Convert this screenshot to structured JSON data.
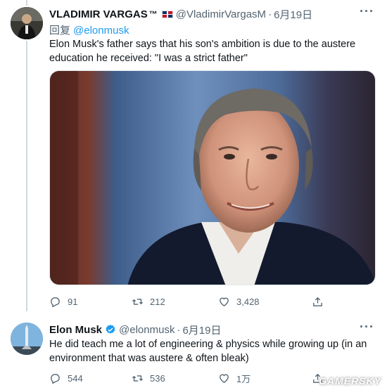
{
  "colors": {
    "accent": "#1d9bf0",
    "muted": "#536471",
    "text": "#0f1419"
  },
  "tweet1": {
    "display_name": "VLADIMIR VARGAS",
    "name_suffix": "™",
    "handle": "@VladimirVargasM",
    "separator": "·",
    "date": "6月19日",
    "reply_prefix": "回复",
    "reply_mention": "@elonmusk",
    "text": "Elon Musk's father says that his son's ambition is due to the austere education he received: \"I was a strict father\"",
    "replies": "91",
    "retweets": "212",
    "likes": "3,428",
    "more_icon": "more-icon",
    "flag_icon": "dominican-flag-icon"
  },
  "tweet2": {
    "display_name": "Elon Musk",
    "handle": "@elonmusk",
    "separator": "·",
    "date": "6月19日",
    "text": "He did teach me a lot of engineering & physics while growing up (in an environment that was austere & often bleak)",
    "replies": "544",
    "retweets": "536",
    "likes": "1万",
    "verified_icon": "verified-badge-icon"
  },
  "watermark": "GAMERSKY"
}
